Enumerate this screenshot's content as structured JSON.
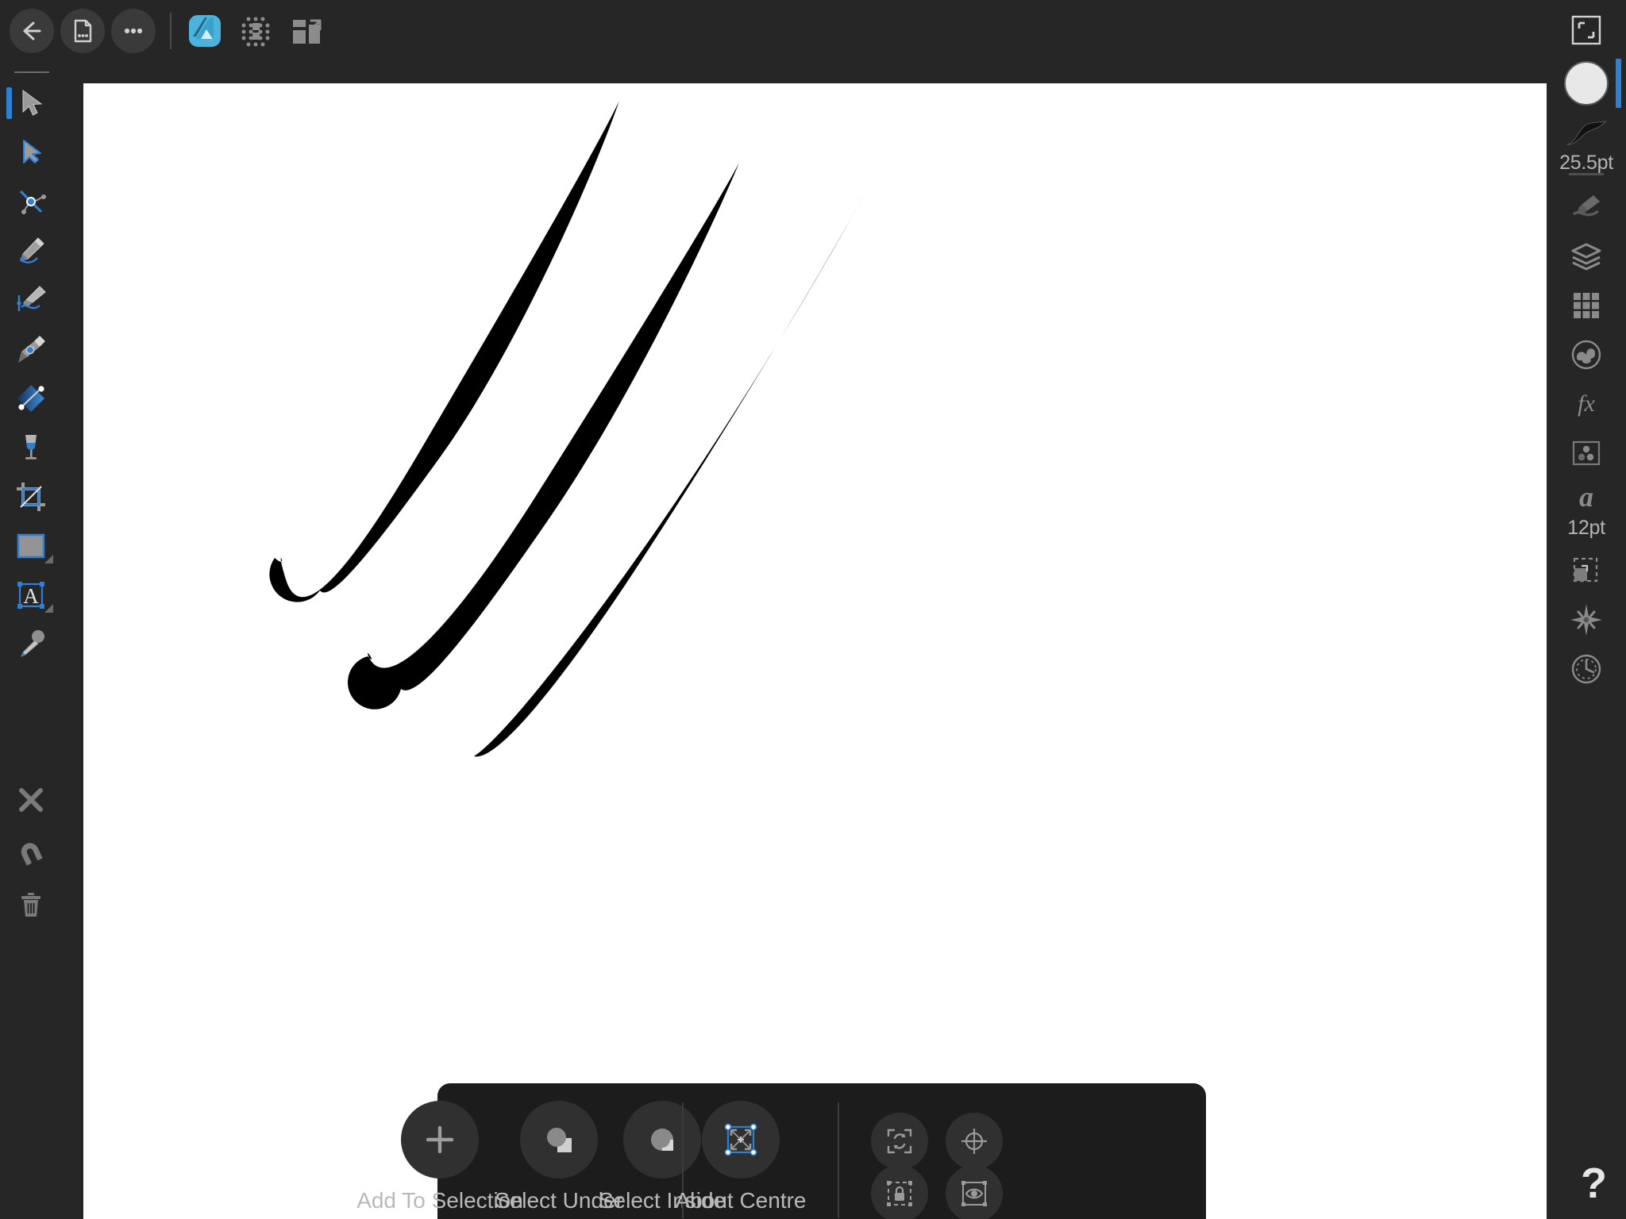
{
  "app": {
    "name": "Affinity Designer",
    "theme": "dark",
    "accent_color": "#2f7fd4",
    "panel_color": "#262626",
    "canvas_color": "#ffffff"
  },
  "top_bar": {
    "items": [
      {
        "name": "back-button",
        "icon": "back-arrow-icon",
        "style": "circle"
      },
      {
        "name": "document-menu-button",
        "icon": "document-ellipsis-icon",
        "style": "circle"
      },
      {
        "name": "more-options-button",
        "icon": "ellipsis-icon",
        "style": "circle"
      },
      {
        "name": "persona-designer-button",
        "icon": "affinity-designer-persona-icon",
        "style": "plain",
        "active": true
      },
      {
        "name": "persona-pixel-button",
        "icon": "pixel-persona-icon",
        "style": "plain",
        "active": false
      },
      {
        "name": "persona-export-button",
        "icon": "export-persona-icon",
        "style": "plain",
        "active": false
      }
    ]
  },
  "tool_rail": {
    "tools": [
      {
        "name": "move-tool",
        "icon": "arrow-cursor-icon",
        "selected": true,
        "flyout": false
      },
      {
        "name": "node-tool",
        "icon": "node-cursor-icon",
        "selected": false,
        "flyout": false
      },
      {
        "name": "corner-tool",
        "icon": "corner-node-icon",
        "selected": false,
        "flyout": false
      },
      {
        "name": "pencil-tool",
        "icon": "pencil-icon",
        "selected": false,
        "flyout": false
      },
      {
        "name": "vector-brush-tool",
        "icon": "paint-brush-icon",
        "selected": false,
        "flyout": false
      },
      {
        "name": "pen-tool",
        "icon": "fountain-pen-nib-icon",
        "selected": false,
        "flyout": false
      },
      {
        "name": "fill-tool",
        "icon": "gradient-fill-icon",
        "selected": false,
        "flyout": false
      },
      {
        "name": "transparency-tool",
        "icon": "wine-glass-icon",
        "selected": false,
        "flyout": false
      },
      {
        "name": "crop-tool",
        "icon": "crop-icon",
        "selected": false,
        "flyout": false
      },
      {
        "name": "shape-tool",
        "icon": "rectangle-shape-icon",
        "selected": false,
        "flyout": true
      },
      {
        "name": "text-tool",
        "icon": "text-frame-a-icon",
        "selected": false,
        "flyout": true
      },
      {
        "name": "colour-picker-tool",
        "icon": "eyedropper-icon",
        "selected": false,
        "flyout": false
      }
    ],
    "bottom_tools": [
      {
        "name": "deselect-button",
        "icon": "close-x-icon"
      },
      {
        "name": "snapping-button",
        "icon": "magnet-icon"
      },
      {
        "name": "delete-button",
        "icon": "trash-can-icon"
      }
    ]
  },
  "right_bar": {
    "items": [
      {
        "name": "document-setup-button",
        "icon": "artboard-frame-icon",
        "label": ""
      },
      {
        "name": "colour-swatch-button",
        "icon": "colour-circle-icon",
        "label": "",
        "swatch_color": "#e8e8e8"
      },
      {
        "name": "stroke-button",
        "icon": "stroke-curve-icon",
        "label": "25.5pt"
      },
      {
        "name": "brush-button",
        "icon": "brush-icon",
        "label": ""
      },
      {
        "name": "layers-button",
        "icon": "layers-stack-icon",
        "label": ""
      },
      {
        "name": "assets-button",
        "icon": "grid-squares-icon",
        "label": ""
      },
      {
        "name": "colour-wheel-button",
        "icon": "colour-wheel-icon",
        "label": ""
      },
      {
        "name": "effects-button",
        "icon": "fx-icon",
        "label": ""
      },
      {
        "name": "adjustment-button",
        "icon": "dots-in-frame-icon",
        "label": ""
      },
      {
        "name": "character-button",
        "icon": "italic-a-icon",
        "label": "12pt"
      },
      {
        "name": "transform-button",
        "icon": "transform-box-icon",
        "label": ""
      },
      {
        "name": "navigator-button",
        "icon": "compass-star-icon",
        "label": ""
      },
      {
        "name": "history-button",
        "icon": "clock-history-icon",
        "label": ""
      }
    ],
    "help": {
      "name": "help-button",
      "icon": "question-mark-icon",
      "glyph": "?"
    }
  },
  "bottom_bar": {
    "actions": [
      {
        "name": "add-to-selection-button",
        "label": "Add To Selection",
        "icon": "plus-icon"
      },
      {
        "name": "select-under-button",
        "label": "Select Under",
        "icon": "select-under-icon"
      },
      {
        "name": "select-inside-button",
        "label": "Select Inside",
        "icon": "select-inside-icon"
      },
      {
        "name": "about-centre-button",
        "label": "About Centre",
        "icon": "transform-about-centre-icon"
      }
    ],
    "toggles": [
      {
        "name": "cycle-selection-button",
        "icon": "cycle-selection-icon"
      },
      {
        "name": "move-origin-button",
        "icon": "target-crosshair-icon"
      },
      {
        "name": "lock-children-button",
        "icon": "lock-in-frame-icon"
      },
      {
        "name": "show-hidden-button",
        "icon": "eye-in-frame-icon"
      }
    ]
  },
  "canvas": {
    "name": "drawing-canvas",
    "background": "#ffffff",
    "strokes": [
      {
        "name": "tapered-stroke-1",
        "color": "#000000",
        "start_cap": "round",
        "end_cap": "point"
      },
      {
        "name": "tapered-stroke-2",
        "color": "#000000",
        "start_cap": "round",
        "end_cap": "point"
      },
      {
        "name": "tapered-stroke-3",
        "color": "#000000",
        "start_cap": "point",
        "end_cap": "point"
      }
    ]
  }
}
